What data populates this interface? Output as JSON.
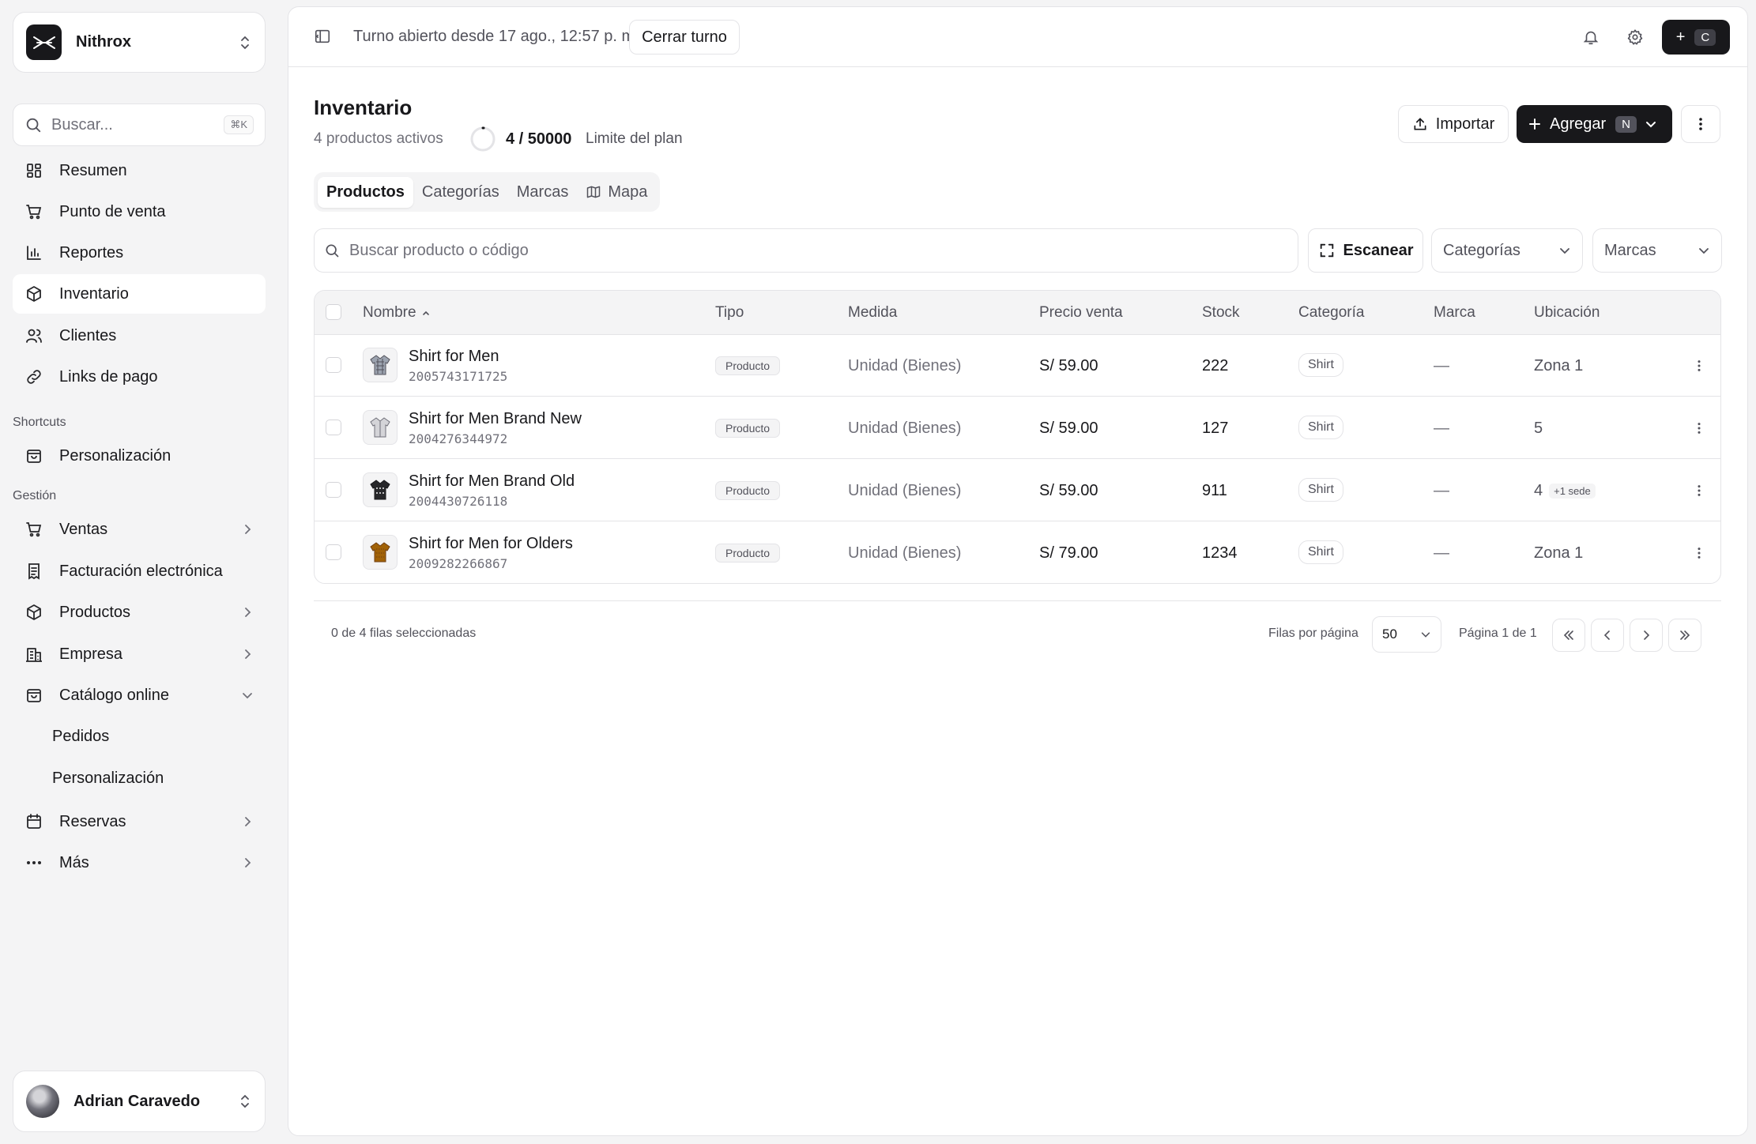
{
  "sidebar": {
    "org_name": "Nithrox",
    "search_placeholder": "Buscar...",
    "search_shortcut": "⌘K",
    "nav": [
      {
        "label": "Resumen",
        "icon": "dashboard-icon"
      },
      {
        "label": "Punto de venta",
        "icon": "cart-icon"
      },
      {
        "label": "Reportes",
        "icon": "bar-chart-icon"
      },
      {
        "label": "Inventario",
        "icon": "box-icon",
        "active": true
      },
      {
        "label": "Clientes",
        "icon": "users-icon"
      },
      {
        "label": "Links de pago",
        "icon": "link-icon"
      }
    ],
    "shortcuts_label": "Shortcuts",
    "shortcuts": [
      {
        "label": "Personalización",
        "icon": "shopping-bag-icon"
      }
    ],
    "gestion_label": "Gestión",
    "gestion": [
      {
        "label": "Ventas",
        "icon": "cart-icon"
      },
      {
        "label": "Facturación electrónica",
        "icon": "receipt-icon"
      },
      {
        "label": "Productos",
        "icon": "box-icon"
      },
      {
        "label": "Empresa",
        "icon": "building-icon"
      },
      {
        "label": "Catálogo online",
        "icon": "shopping-bag-icon",
        "expanded": true
      },
      {
        "label": "Pedidos"
      },
      {
        "label": "Personalización"
      },
      {
        "label": "Reservas",
        "icon": "calendar-icon"
      },
      {
        "label": "Más",
        "icon": "more-horizontal-icon"
      }
    ],
    "user_name": "Adrian Caravedo"
  },
  "topbar": {
    "shift_text": "Turno abierto desde 17 ago., 12:57 p. m.",
    "close_shift": "Cerrar turno",
    "quick_add_symbol": "+",
    "quick_add_key": "C"
  },
  "page": {
    "title": "Inventario",
    "active_products": "4 productos activos",
    "plan_count": "4 / 50000",
    "plan_label": "Limite del plan",
    "import_label": "Importar",
    "add_label": "Agregar",
    "add_key": "N"
  },
  "tabs": [
    "Productos",
    "Categorías",
    "Marcas",
    "Mapa"
  ],
  "filters": {
    "search_placeholder": "Buscar producto o código",
    "scan_label": "Escanear",
    "categories_placeholder": "Categorías",
    "brands_placeholder": "Marcas"
  },
  "table": {
    "headers": [
      "Nombre",
      "Tipo",
      "Medida",
      "Precio venta",
      "Stock",
      "Categoría",
      "Marca",
      "Ubicación"
    ],
    "rows": [
      {
        "name": "Shirt for Men",
        "code": "2005743171725",
        "type": "Producto",
        "measure": "Unidad (Bienes)",
        "price": "S/ 59.00",
        "stock": "222",
        "category": "Shirt",
        "brand": "—",
        "location": "Zona 1",
        "extra": "",
        "thumb_color": "#9ca3af"
      },
      {
        "name": "Shirt for Men Brand New",
        "code": "2004276344972",
        "type": "Producto",
        "measure": "Unidad (Bienes)",
        "price": "S/ 59.00",
        "stock": "127",
        "category": "Shirt",
        "brand": "—",
        "location": "5",
        "extra": "",
        "thumb_color": "#d4d4d8"
      },
      {
        "name": "Shirt for Men Brand Old",
        "code": "2004430726118",
        "type": "Producto",
        "measure": "Unidad (Bienes)",
        "price": "S/ 59.00",
        "stock": "911",
        "category": "Shirt",
        "brand": "—",
        "location": "4",
        "extra": "+1 sede",
        "thumb_color": "#27272a"
      },
      {
        "name": "Shirt for Men for Olders",
        "code": "2009282266867",
        "type": "Producto",
        "measure": "Unidad (Bienes)",
        "price": "S/ 79.00",
        "stock": "1234",
        "category": "Shirt",
        "brand": "—",
        "location": "Zona 1",
        "extra": "",
        "thumb_color": "#a16207"
      }
    ]
  },
  "pagination": {
    "selection": "0 de 4 filas seleccionadas",
    "rows_per_page_label": "Filas por página",
    "rows_per_page": "50",
    "page_label": "Página 1 de 1"
  }
}
